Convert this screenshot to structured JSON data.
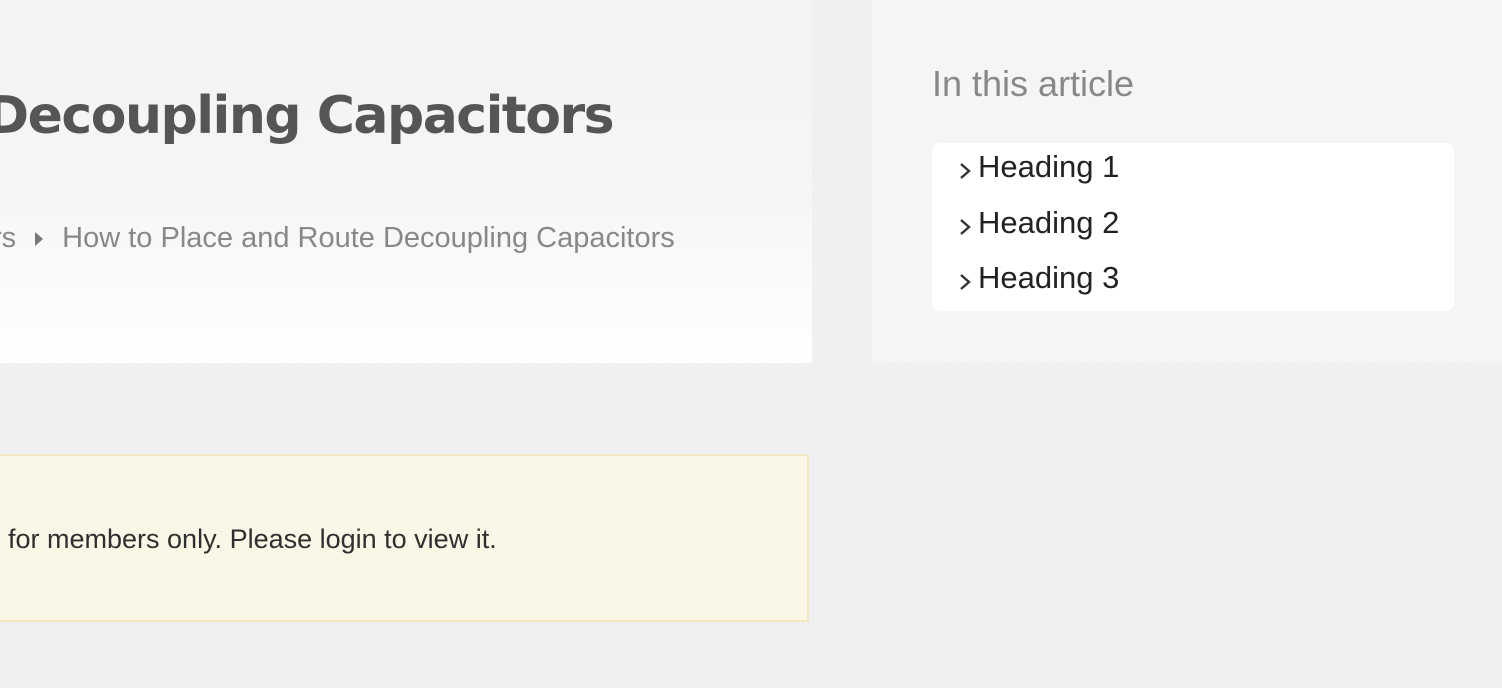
{
  "article": {
    "title": "Decoupling Capacitors",
    "breadcrumb": {
      "previous": "rs",
      "current": "How to Place and Route Decoupling Capacitors"
    },
    "notice": "for members only. Please login to view it."
  },
  "toc": {
    "title": "In this article",
    "items": [
      {
        "label": "Heading 1",
        "icon": "chevron-right-icon"
      },
      {
        "label": "Heading 2",
        "icon": "chevron-right-icon"
      },
      {
        "label": "Heading 3",
        "icon": "chevron-right-icon"
      }
    ]
  },
  "colors": {
    "title": "#555555",
    "breadcrumb": "#888888",
    "notice_bg": "#faf7e6",
    "notice_border": "#f3e7c2",
    "sidebar_bg": "#f5f5f5"
  }
}
